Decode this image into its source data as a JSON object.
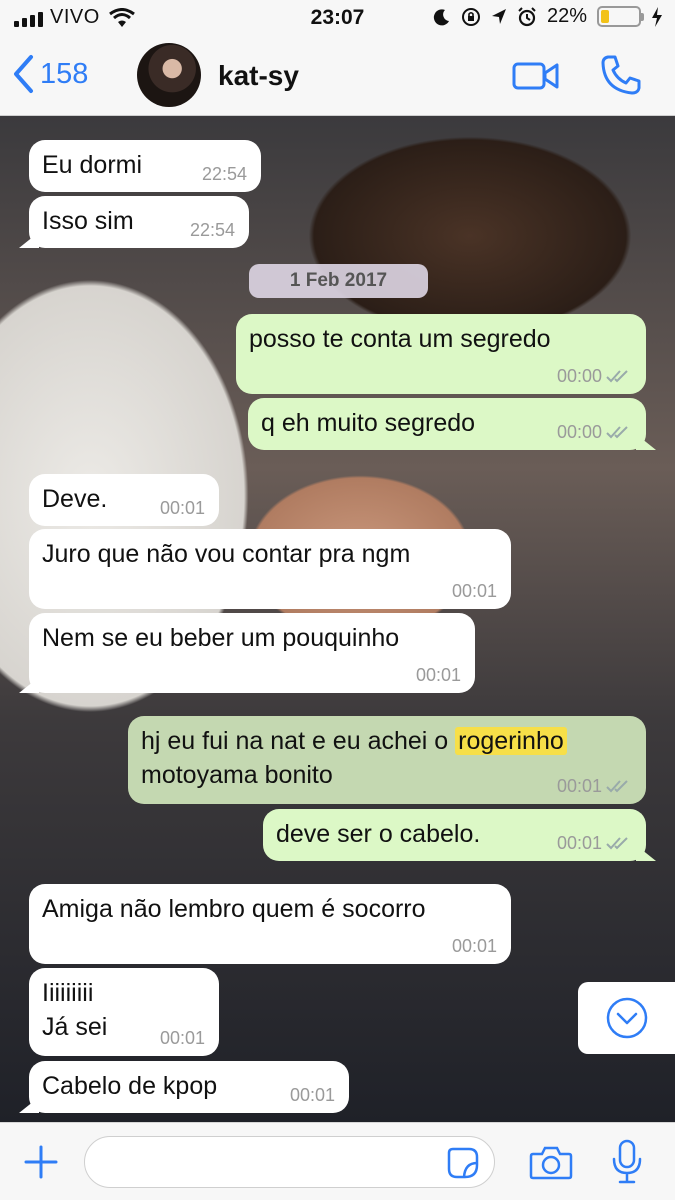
{
  "status_bar": {
    "carrier": "VIVO",
    "time": "23:07",
    "battery_percent": "22%",
    "battery_level": 0.22,
    "battery_color": "#f2c218",
    "icons": [
      "signal-icon",
      "wifi-icon",
      "moon-icon",
      "orientation-lock-icon",
      "location-icon",
      "alarm-icon",
      "battery-icon",
      "charging-icon"
    ]
  },
  "header": {
    "back_count": "158",
    "contact_name": "kat-sy",
    "icons": [
      "chevron-left-icon",
      "video-call-icon",
      "phone-icon"
    ],
    "accent": "#2f7df6"
  },
  "chat": {
    "date_separator": "1 Feb 2017",
    "messages": [
      {
        "dir": "in",
        "text": "Eu dormi",
        "time": "22:54"
      },
      {
        "dir": "in",
        "text": "Isso sim",
        "time": "22:54"
      },
      {
        "dir": "out",
        "text": "posso te conta um segredo",
        "time": "00:00"
      },
      {
        "dir": "out",
        "text": "q eh muito segredo",
        "time": "00:00"
      },
      {
        "dir": "in",
        "text": "Deve.",
        "time": "00:01"
      },
      {
        "dir": "in",
        "text": "Juro que não vou contar pra ngm",
        "time": "00:01"
      },
      {
        "dir": "in",
        "text": "Nem se eu beber um pouquinho",
        "time": "00:01"
      },
      {
        "dir": "out",
        "text_before": "hj eu fui na nat e eu achei o ",
        "highlight": "rogerinho",
        "text_after": "motoyama bonito",
        "time": "00:01"
      },
      {
        "dir": "out",
        "text": "deve ser o cabelo.",
        "time": "00:01"
      },
      {
        "dir": "in",
        "text": "Amiga não lembro quem é socorro",
        "time": "00:01"
      },
      {
        "dir": "in",
        "line1": "Iiiiiiiii",
        "line2": "Já sei",
        "time": "00:01"
      },
      {
        "dir": "in",
        "text": "Cabelo de kpop",
        "time": "00:01"
      }
    ],
    "colors": {
      "incoming": "#ffffff",
      "outgoing": "#dcf8c6",
      "highlight": "#f7df48"
    }
  },
  "input_bar": {
    "placeholder": "",
    "icons": [
      "plus-icon",
      "sticker-icon",
      "camera-icon",
      "microphone-icon"
    ]
  }
}
